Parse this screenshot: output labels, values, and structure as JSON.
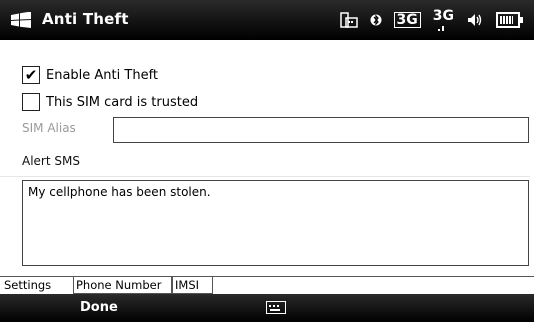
{
  "titlebar": {
    "title": "Anti Theft",
    "icons": [
      "windows-logo-icon",
      "keyboard-sim-icon",
      "bluetooth-icon",
      "3g-data-icon",
      "3g-signal-icon",
      "volume-icon",
      "battery-icon"
    ],
    "status_3g_box": "3G",
    "status_3g_signal": "3G"
  },
  "form": {
    "enable_label": "Enable Anti Theft",
    "enable_checked": true,
    "trusted_label": "This SIM card is trusted",
    "trusted_checked": false,
    "sim_alias_label": "SIM Alias",
    "sim_alias_value": "",
    "alert_sms_label": "Alert SMS",
    "alert_sms_value": "My cellphone has been stolen."
  },
  "tabs": [
    {
      "label": "Settings",
      "active": true
    },
    {
      "label": "Phone Number",
      "active": false
    },
    {
      "label": "IMSI",
      "active": false
    }
  ],
  "softkeys": {
    "left": "Done"
  }
}
